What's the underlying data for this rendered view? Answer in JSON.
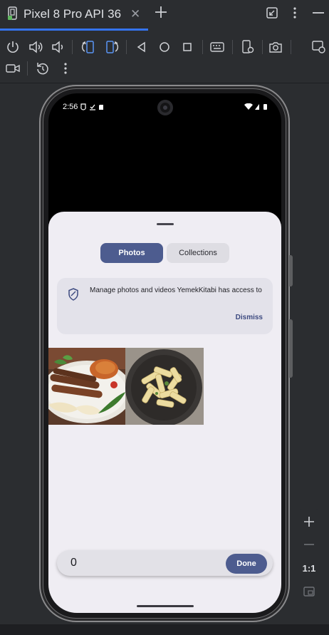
{
  "window": {
    "tab_title": "Pixel 8 Pro API 36",
    "tab_close_icon": "close-icon",
    "accent_color": "#3574f0"
  },
  "toolbar": {
    "icons": [
      "power-icon",
      "volume-up-icon",
      "volume-down-icon",
      "rotate-left-icon",
      "rotate-right-icon",
      "back-icon",
      "home-icon",
      "overview-icon",
      "keyboard-icon",
      "device-settings-icon",
      "screenshot-icon",
      "snapshot-icon",
      "record-icon",
      "reset-icon",
      "more-icon"
    ]
  },
  "device": {
    "status": {
      "time": "2:56"
    },
    "picker": {
      "tabs": [
        {
          "label": "Photos",
          "selected": true
        },
        {
          "label": "Collections",
          "selected": false
        }
      ],
      "banner": {
        "text": "Manage photos and videos YemekKitabi has access to",
        "dismiss": "Dismiss"
      },
      "photos": [
        {
          "name": "kebab-photo"
        },
        {
          "name": "pasta-photo"
        }
      ],
      "selected_count": "0",
      "done_label": "Done",
      "accent_color": "#4d5c8f"
    }
  },
  "zoom": {
    "label": "1:1"
  }
}
